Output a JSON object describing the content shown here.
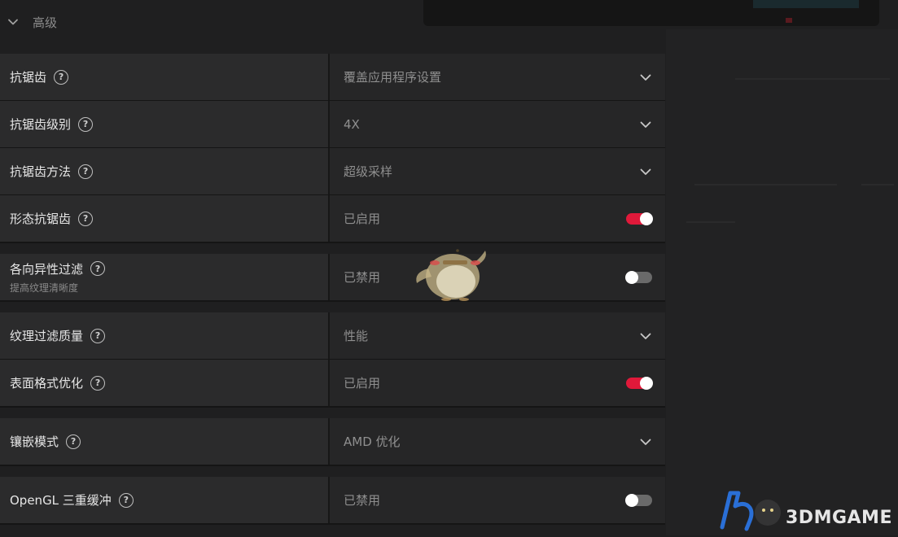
{
  "section": {
    "title": "高级",
    "expanded": true
  },
  "settings": [
    {
      "label": "抗锯齿",
      "sublabel": "",
      "type": "dropdown",
      "value": "覆盖应用程序设置"
    },
    {
      "label": "抗锯齿级别",
      "sublabel": "",
      "type": "dropdown",
      "value": "4X"
    },
    {
      "label": "抗锯齿方法",
      "sublabel": "",
      "type": "dropdown",
      "value": "超级采样"
    },
    {
      "label": "形态抗锯齿",
      "sublabel": "",
      "type": "toggle",
      "value": "已启用",
      "on": true
    },
    {
      "label": "各向异性过滤",
      "sublabel": "提高纹理清晰度",
      "type": "toggle",
      "value": "已禁用",
      "on": false
    },
    {
      "label": "纹理过滤质量",
      "sublabel": "",
      "type": "dropdown",
      "value": "性能"
    },
    {
      "label": "表面格式优化",
      "sublabel": "",
      "type": "toggle",
      "value": "已启用",
      "on": true
    },
    {
      "label": "镶嵌模式",
      "sublabel": "",
      "type": "dropdown",
      "value": "AMD 优化"
    },
    {
      "label": "OpenGL 三重缓冲",
      "sublabel": "",
      "type": "toggle",
      "value": "已禁用",
      "on": false
    }
  ],
  "help_glyph": "?",
  "watermark": {
    "text": "3DMGAME"
  },
  "colors": {
    "toggle_on": "#e0193a",
    "toggle_off": "#6a6a6a",
    "background": "#1f1f20"
  }
}
